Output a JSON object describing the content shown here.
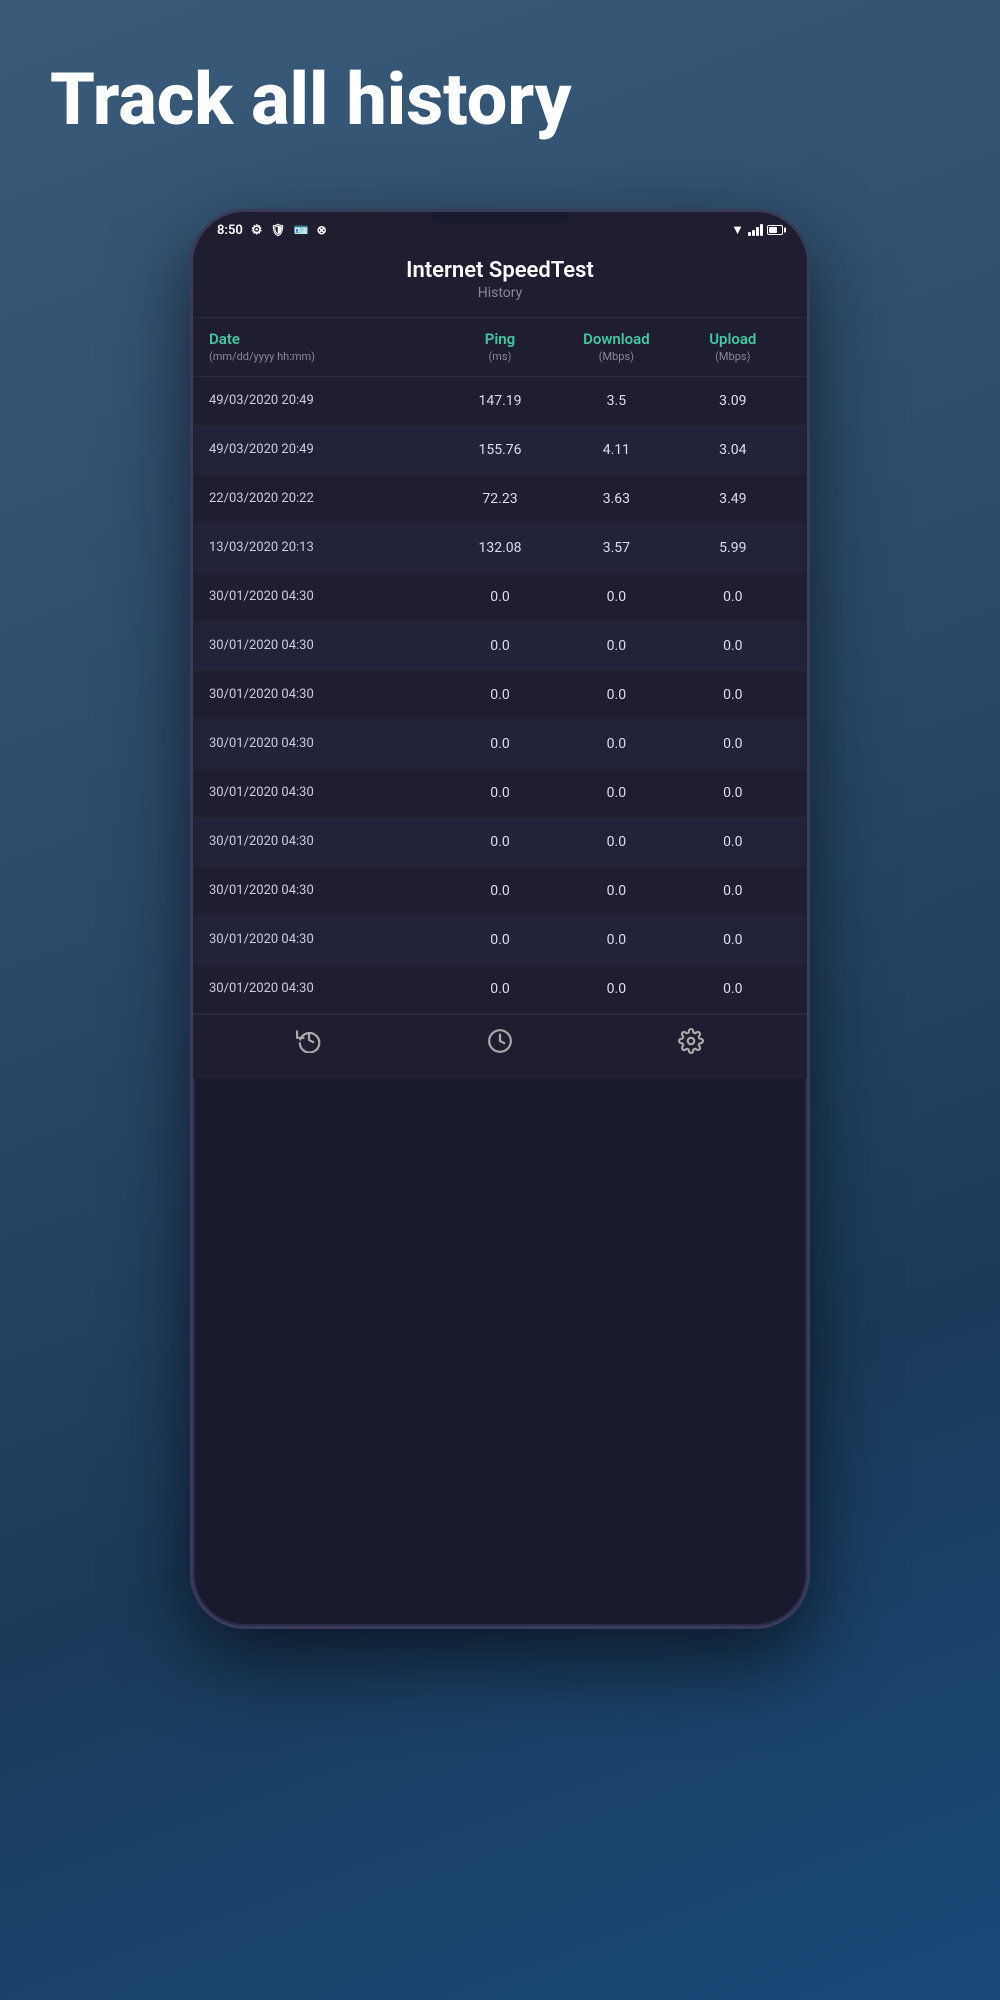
{
  "page": {
    "headline": "Track all history",
    "background_gradient": "linear-gradient(160deg, #3a5a7a, #1a4a7a)"
  },
  "status_bar": {
    "time": "8:50",
    "icons": [
      "gear-icon",
      "shield-icon",
      "wallet-icon",
      "ring-icon"
    ]
  },
  "app": {
    "title": "Internet SpeedTest",
    "subtitle": "History"
  },
  "table": {
    "columns": [
      {
        "name": "Date",
        "unit": "(mm/dd/yyyy hh:mm)"
      },
      {
        "name": "Ping",
        "unit": "(ms)"
      },
      {
        "name": "Download",
        "unit": "(Mbps)"
      },
      {
        "name": "Upload",
        "unit": "(Mbps)"
      }
    ],
    "rows": [
      {
        "date": "49/03/2020 20:49",
        "ping": "147.19",
        "download": "3.5",
        "upload": "3.09"
      },
      {
        "date": "49/03/2020 20:49",
        "ping": "155.76",
        "download": "4.11",
        "upload": "3.04"
      },
      {
        "date": "22/03/2020 20:22",
        "ping": "72.23",
        "download": "3.63",
        "upload": "3.49"
      },
      {
        "date": "13/03/2020 20:13",
        "ping": "132.08",
        "download": "3.57",
        "upload": "5.99"
      },
      {
        "date": "30/01/2020 04:30",
        "ping": "0.0",
        "download": "0.0",
        "upload": "0.0"
      },
      {
        "date": "30/01/2020 04:30",
        "ping": "0.0",
        "download": "0.0",
        "upload": "0.0"
      },
      {
        "date": "30/01/2020 04:30",
        "ping": "0.0",
        "download": "0.0",
        "upload": "0.0"
      },
      {
        "date": "30/01/2020 04:30",
        "ping": "0.0",
        "download": "0.0",
        "upload": "0.0"
      },
      {
        "date": "30/01/2020 04:30",
        "ping": "0.0",
        "download": "0.0",
        "upload": "0.0"
      },
      {
        "date": "30/01/2020 04:30",
        "ping": "0.0",
        "download": "0.0",
        "upload": "0.0"
      },
      {
        "date": "30/01/2020 04:30",
        "ping": "0.0",
        "download": "0.0",
        "upload": "0.0"
      },
      {
        "date": "30/01/2020 04:30",
        "ping": "0.0",
        "download": "0.0",
        "upload": "0.0"
      },
      {
        "date": "30/01/2020 04:30",
        "ping": "0.0",
        "download": "0.0",
        "upload": "0.0"
      }
    ]
  },
  "bottom_nav": {
    "items": [
      {
        "label": "",
        "icon": "history-icon"
      },
      {
        "label": "",
        "icon": "speedtest-icon"
      },
      {
        "label": "",
        "icon": "settings-icon"
      }
    ]
  }
}
